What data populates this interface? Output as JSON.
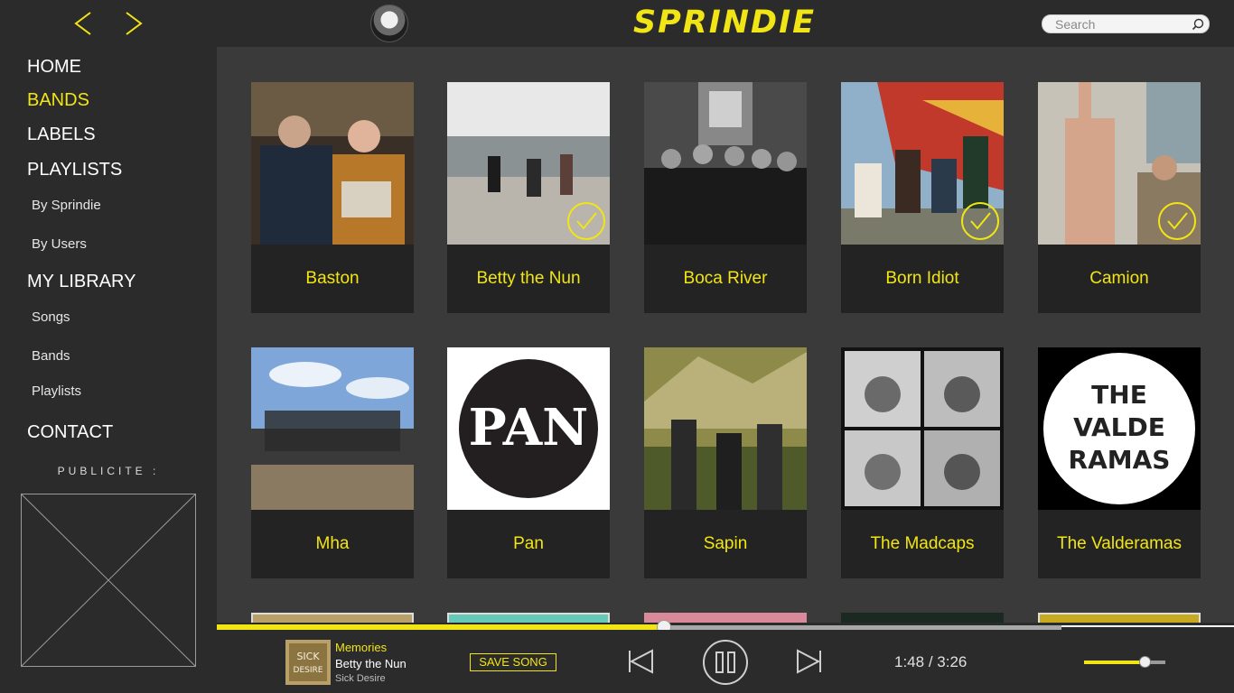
{
  "app": {
    "logo": "SPRINDIE",
    "accent_color": "#f2e515"
  },
  "nav": {
    "back_icon": "chevron-left-icon",
    "forward_icon": "chevron-right-icon"
  },
  "search": {
    "placeholder": "Search",
    "icon": "search-icon"
  },
  "sidebar": {
    "home": "HOME",
    "bands": "BANDS",
    "labels": "LABELS",
    "playlists": "PLAYLISTS",
    "by_sprindie": "By Sprindie",
    "by_users": "By Users",
    "my_library": "MY LIBRARY",
    "songs": "Songs",
    "lib_bands": "Bands",
    "lib_playlists": "Playlists",
    "contact": "CONTACT",
    "active_item": "BANDS",
    "ad_label": "PUBLICITE :"
  },
  "bands": [
    {
      "name": "Baston",
      "followed": false
    },
    {
      "name": "Betty the Nun",
      "followed": true
    },
    {
      "name": "Boca River",
      "followed": false
    },
    {
      "name": "Born Idiot",
      "followed": true
    },
    {
      "name": "Camion",
      "followed": true
    },
    {
      "name": "Mha",
      "followed": false
    },
    {
      "name": "Pan",
      "followed": false
    },
    {
      "name": "Sapin",
      "followed": false
    },
    {
      "name": "The Madcaps",
      "followed": false
    },
    {
      "name": "The Valderamas",
      "followed": false
    }
  ],
  "player": {
    "song_title": "Memories",
    "artist": "Betty the Nun",
    "album": "Sick Desire",
    "save_label": "SAVE SONG",
    "elapsed": "1:48",
    "separator": "/",
    "duration": "3:26",
    "progress_fraction": 0.44,
    "buffer_fraction": 0.83,
    "volume_fraction": 0.74,
    "icons": [
      "skip-previous-icon",
      "pause-icon",
      "skip-next-icon"
    ]
  }
}
